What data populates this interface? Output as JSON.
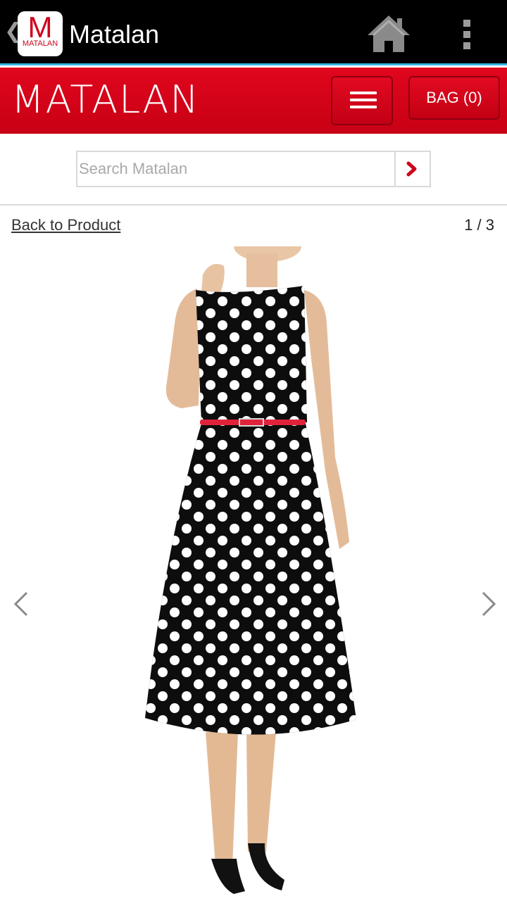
{
  "actionbar": {
    "app_title": "Matalan",
    "app_icon_letter": "M",
    "app_icon_text": "MATALAN",
    "home_icon": "home-icon",
    "overflow_icon": "overflow-menu-icon"
  },
  "header": {
    "logo": "MATALAN",
    "menu_icon": "hamburger-icon",
    "bag_label": "BAG (0)"
  },
  "search": {
    "placeholder": "Search Matalan",
    "value": "",
    "submit_icon": "chevron-right-icon"
  },
  "gallery": {
    "back_link": "Back to Product",
    "pager": "1 / 3",
    "image": "woman-in-black-polka-dot-dress-with-red-belt",
    "prev_icon": "chevron-left-icon",
    "next_icon": "chevron-right-icon"
  },
  "colors": {
    "brand_red": "#d0021b",
    "actionbar": "#000000",
    "holo_blue": "#33b5e5"
  }
}
